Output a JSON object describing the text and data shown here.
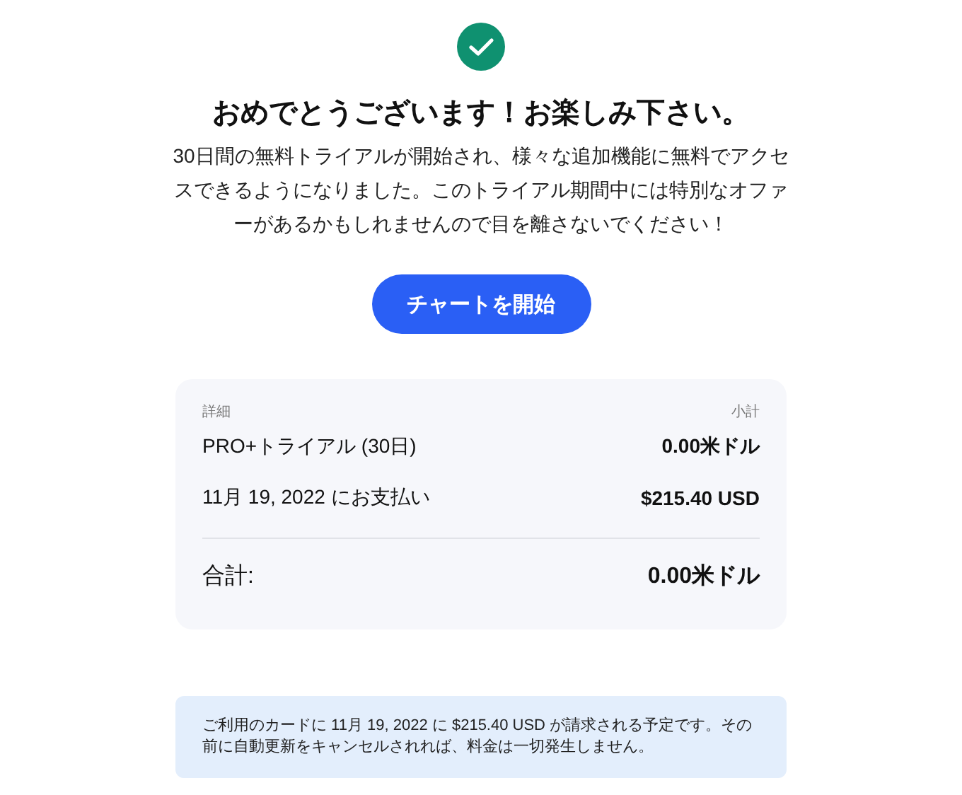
{
  "title": "おめでとうございます！お楽しみ下さい。",
  "message": "30日間の無料トライアルが開始され、様々な追加機能に無料でアクセスできるようになりました。このトライアル期間中には特別なオファーがあるかもしれませんので目を離さないでください！",
  "button": "チャートを開始",
  "summary": {
    "columns": [
      "詳細",
      "小計"
    ],
    "rows": [
      {
        "label": "PRO+トライアル (30日)",
        "amount": "0.00米ドル",
        "kind": "item"
      },
      {
        "label": "11月 19, 2022 にお支払い",
        "amount": "$215.40 USD",
        "kind": "item"
      },
      {
        "label": "合計:",
        "amount": "0.00米ドル",
        "kind": "total"
      }
    ]
  },
  "notice": "ご利用のカードに 11月 19, 2022 に $215.40 USD が請求される予定です。その前に自動更新をキャンセルされれば、料金は一切発生しません。"
}
